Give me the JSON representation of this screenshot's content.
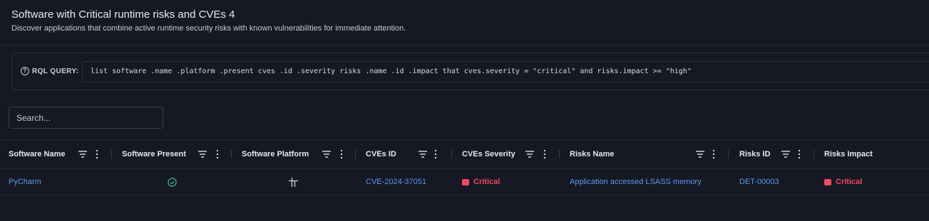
{
  "header": {
    "title": "Software with Critical runtime risks and CVEs 4",
    "subtitle": "Discover applications that combine active runtime security risks with known vulnerabilities for immediate attention."
  },
  "query": {
    "label": "RQL QUERY:",
    "text": "list software .name .platform .present cves .id .severity risks .name .id .impact that cves.severity = \"critical\" and risks.impact >= \"high\""
  },
  "search": {
    "placeholder": "Search..."
  },
  "table": {
    "columns": [
      {
        "label": "Software Name"
      },
      {
        "label": "Software Present"
      },
      {
        "label": "Software Platform"
      },
      {
        "label": "CVEs ID"
      },
      {
        "label": "CVEs Severity"
      },
      {
        "label": "Risks Name"
      },
      {
        "label": "Risks ID"
      },
      {
        "label": "Risks Impact"
      }
    ],
    "rows": [
      {
        "software_name": "PyCharm",
        "software_present_icon": "check-circle-icon",
        "software_platform_icon": "windows-icon",
        "cve_id": "CVE-2024-37051",
        "cve_severity": "Critical",
        "risk_name": "Application accessed LSASS memory",
        "risk_id": "DET-00003",
        "risk_impact": "Critical"
      }
    ]
  },
  "colors": {
    "link": "#5b9bf0",
    "critical": "#f04a63",
    "success": "#3fbf8f"
  }
}
